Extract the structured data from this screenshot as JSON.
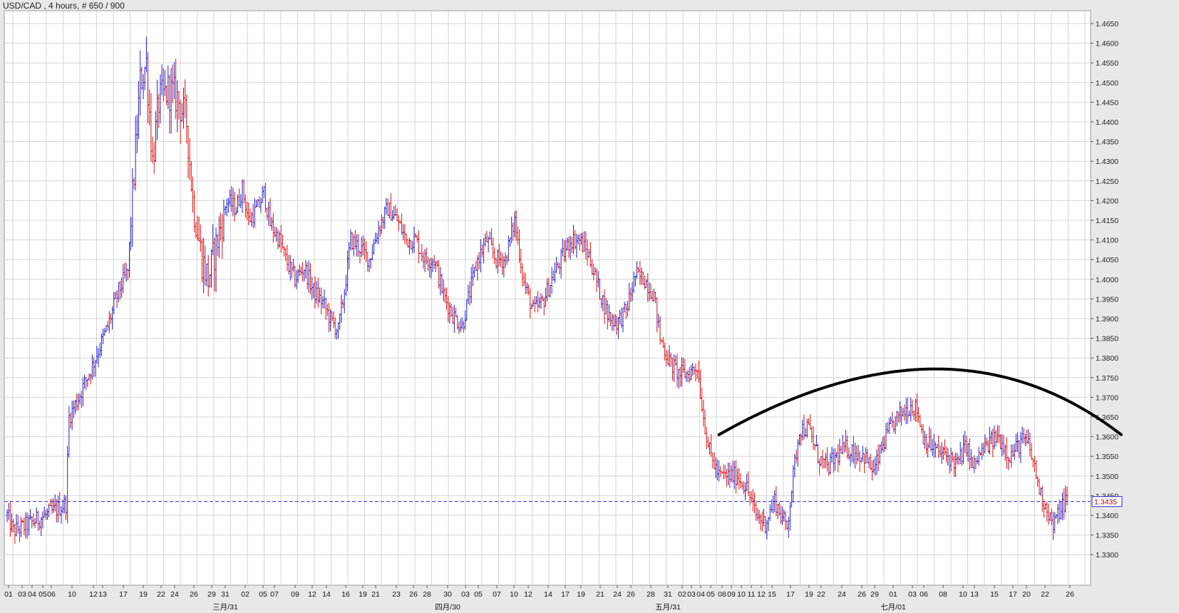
{
  "title": "USD/CAD , 4 hours, # 650 / 900",
  "chart_data": {
    "type": "ohlc",
    "symbol": "USD/CAD",
    "timeframe": "4 hours",
    "grid": true,
    "ylim": [
      1.33,
      1.4675
    ],
    "yticks": [
      "1.3300",
      "1.3350",
      "1.3400",
      "1.3450",
      "1.3500",
      "1.3550",
      "1.3600",
      "1.3650",
      "1.3700",
      "1.3750",
      "1.3800",
      "1.3850",
      "1.3900",
      "1.3950",
      "1.4000",
      "1.4050",
      "1.4100",
      "1.4150",
      "1.4200",
      "1.4250",
      "1.4300",
      "1.4350",
      "1.4400",
      "1.4450",
      "1.4500",
      "1.4550",
      "1.4600",
      "1.4650"
    ],
    "current_price": "1.3435",
    "day_labels": [
      "01",
      "03",
      "04",
      "05",
      "06",
      "10",
      "12",
      "13",
      "17",
      "19",
      "22",
      "24",
      "26",
      "29",
      "31",
      "02",
      "05",
      "07",
      "09",
      "12",
      "14",
      "16",
      "19",
      "21",
      "23",
      "26",
      "28",
      "30",
      "03",
      "05",
      "07",
      "10",
      "12",
      "14",
      "17",
      "19",
      "21",
      "24",
      "26",
      "28",
      "31",
      "02",
      "03",
      "04",
      "05",
      "08",
      "09",
      "10",
      "11",
      "12",
      "15",
      "17",
      "19",
      "22",
      "24",
      "26",
      "29",
      "01",
      "03",
      "06",
      "08",
      "10",
      "13",
      "15",
      "17",
      "20",
      "22",
      "26"
    ],
    "month_labels": [
      "三月/31",
      "四月/30",
      "五月/31",
      "七月/01"
    ],
    "anchors": [
      [
        0,
        1.34
      ],
      [
        4,
        1.336
      ],
      [
        10,
        1.337
      ],
      [
        20,
        1.339
      ],
      [
        30,
        1.341
      ],
      [
        38,
        1.343
      ],
      [
        40,
        1.365
      ],
      [
        45,
        1.369
      ],
      [
        55,
        1.378
      ],
      [
        65,
        1.388
      ],
      [
        72,
        1.397
      ],
      [
        78,
        1.402
      ],
      [
        82,
        1.427
      ],
      [
        86,
        1.45
      ],
      [
        90,
        1.455
      ],
      [
        94,
        1.43
      ],
      [
        98,
        1.445
      ],
      [
        104,
        1.448
      ],
      [
        110,
        1.446
      ],
      [
        116,
        1.44
      ],
      [
        120,
        1.42
      ],
      [
        126,
        1.405
      ],
      [
        130,
        1.4
      ],
      [
        136,
        1.41
      ],
      [
        142,
        1.42
      ],
      [
        148,
        1.418
      ],
      [
        152,
        1.423
      ],
      [
        156,
        1.415
      ],
      [
        162,
        1.418
      ],
      [
        166,
        1.422
      ],
      [
        170,
        1.414
      ],
      [
        176,
        1.41
      ],
      [
        180,
        1.405
      ],
      [
        186,
        1.4
      ],
      [
        192,
        1.403
      ],
      [
        198,
        1.397
      ],
      [
        204,
        1.394
      ],
      [
        210,
        1.389
      ],
      [
        214,
        1.387
      ],
      [
        218,
        1.397
      ],
      [
        222,
        1.41
      ],
      [
        228,
        1.408
      ],
      [
        234,
        1.405
      ],
      [
        240,
        1.413
      ],
      [
        246,
        1.418
      ],
      [
        252,
        1.415
      ],
      [
        258,
        1.41
      ],
      [
        264,
        1.41
      ],
      [
        270,
        1.405
      ],
      [
        276,
        1.405
      ],
      [
        282,
        1.396
      ],
      [
        288,
        1.391
      ],
      [
        294,
        1.388
      ],
      [
        298,
        1.395
      ],
      [
        304,
        1.405
      ],
      [
        310,
        1.41
      ],
      [
        316,
        1.405
      ],
      [
        322,
        1.405
      ],
      [
        328,
        1.415
      ],
      [
        334,
        1.399
      ],
      [
        340,
        1.392
      ],
      [
        346,
        1.394
      ],
      [
        352,
        1.4
      ],
      [
        358,
        1.405
      ],
      [
        364,
        1.41
      ],
      [
        370,
        1.41
      ],
      [
        376,
        1.406
      ],
      [
        382,
        1.398
      ],
      [
        388,
        1.391
      ],
      [
        394,
        1.389
      ],
      [
        400,
        1.392
      ],
      [
        406,
        1.401
      ],
      [
        412,
        1.4
      ],
      [
        418,
        1.396
      ],
      [
        422,
        1.385
      ],
      [
        428,
        1.379
      ],
      [
        434,
        1.376
      ],
      [
        440,
        1.376
      ],
      [
        446,
        1.378
      ],
      [
        450,
        1.365
      ],
      [
        454,
        1.356
      ],
      [
        460,
        1.35
      ],
      [
        466,
        1.35
      ],
      [
        472,
        1.35
      ],
      [
        478,
        1.347
      ],
      [
        484,
        1.34
      ],
      [
        490,
        1.338
      ],
      [
        496,
        1.344
      ],
      [
        500,
        1.34
      ],
      [
        504,
        1.337
      ],
      [
        508,
        1.35
      ],
      [
        512,
        1.362
      ],
      [
        518,
        1.362
      ],
      [
        524,
        1.355
      ],
      [
        530,
        1.352
      ],
      [
        536,
        1.355
      ],
      [
        542,
        1.357
      ],
      [
        548,
        1.356
      ],
      [
        554,
        1.355
      ],
      [
        560,
        1.351
      ],
      [
        566,
        1.358
      ],
      [
        572,
        1.363
      ],
      [
        578,
        1.366
      ],
      [
        584,
        1.368
      ],
      [
        588,
        1.367
      ],
      [
        592,
        1.36
      ],
      [
        596,
        1.358
      ],
      [
        602,
        1.356
      ],
      [
        608,
        1.355
      ],
      [
        614,
        1.353
      ],
      [
        620,
        1.358
      ],
      [
        624,
        1.352
      ],
      [
        628,
        1.355
      ],
      [
        634,
        1.358
      ],
      [
        640,
        1.36
      ],
      [
        644,
        1.358
      ],
      [
        648,
        1.355
      ],
      [
        652,
        1.357
      ],
      [
        656,
        1.359
      ],
      [
        660,
        1.358
      ],
      [
        664,
        1.352
      ],
      [
        668,
        1.345
      ],
      [
        672,
        1.342
      ],
      [
        676,
        1.337
      ],
      [
        680,
        1.341
      ],
      [
        684,
        1.344
      ]
    ]
  },
  "trend_curve": {
    "color": "#000000",
    "points": [
      [
        460,
        1.3605
      ],
      [
        600,
        1.3772
      ],
      [
        720,
        1.3605
      ]
    ]
  },
  "colors": {
    "up": "#2222cc",
    "down": "#dd1111",
    "grid": "#d4d4d4",
    "current_line": "#2c2cd0",
    "background": "#ffffff",
    "panel": "#e8e8e8"
  }
}
